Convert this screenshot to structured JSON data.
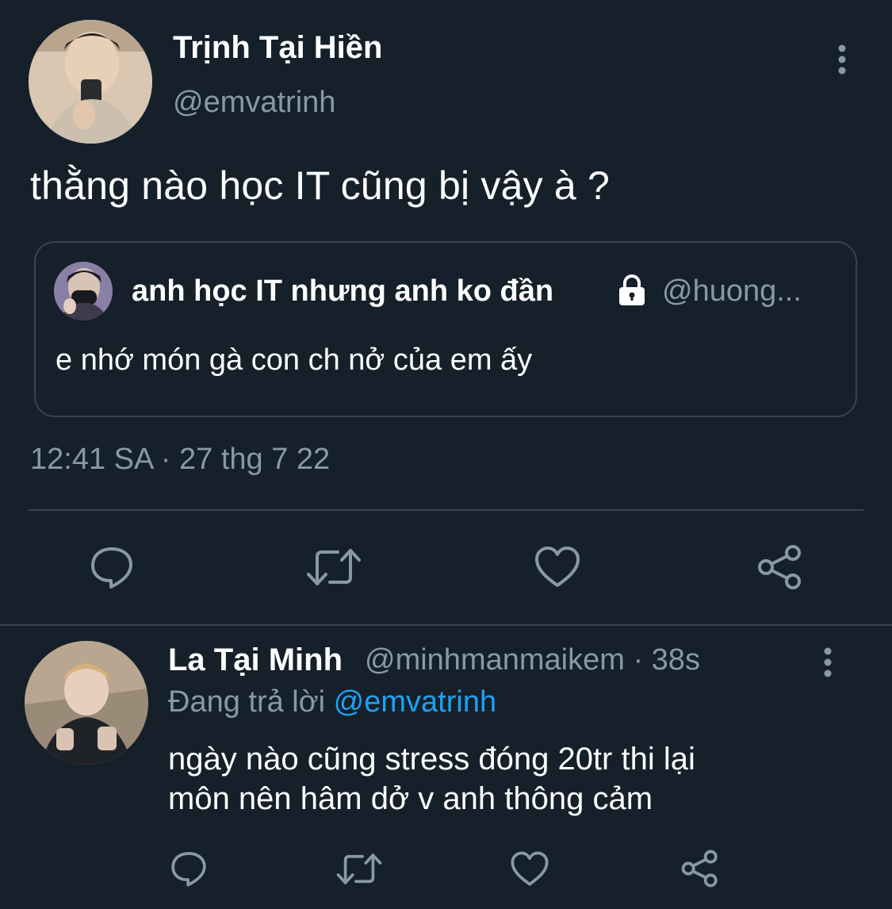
{
  "main_tweet": {
    "author_name": "Trịnh Tại Hiền",
    "author_handle": "@emvatrinh",
    "text": "thằng nào học IT cũng bị vậy à ?",
    "quoted": {
      "author_name": "anh học IT nhưng anh ko đần",
      "author_handle": "@huong...",
      "text": "e nhớ món gà con ch nở của em ấy"
    },
    "timestamp": "12:41 SA · 27 thg 7 22",
    "actions": [
      "reply-icon",
      "retweet-icon",
      "like-icon",
      "share-icon"
    ]
  },
  "reply": {
    "author_name": "La Tại Minh",
    "author_handle": "@minhmanmaikem",
    "separator": " · ",
    "time": "38s",
    "replying_prefix": "Đang trả lời ",
    "replying_to": "@emvatrinh",
    "text_lines": [
      "ngày nào cũng stress đóng 20tr thi lại",
      "môn nên hâm dở v anh thông cảm"
    ],
    "actions": [
      "reply-icon",
      "retweet-icon",
      "like-icon",
      "share-icon"
    ]
  },
  "colors": {
    "background": "#15202b",
    "secondary_text": "#8899a6",
    "border": "#38444d",
    "link": "#1da1f2",
    "primary_text": "#ffffff"
  }
}
